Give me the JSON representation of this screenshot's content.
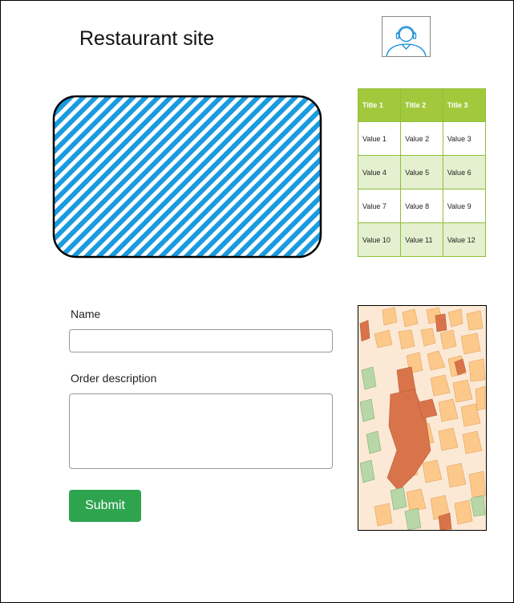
{
  "header": {
    "title": "Restaurant site",
    "avatar_icon": "user-headset-icon"
  },
  "hero": {
    "image_icon": "hatched-image-placeholder",
    "fill_color": "#1a9be0"
  },
  "table": {
    "headers": [
      "Title 1",
      "Title 2",
      "Title 3"
    ],
    "rows": [
      [
        "Value 1",
        "Value 2",
        "Value 3"
      ],
      [
        "Value 4",
        "Value 5",
        "Value 6"
      ],
      [
        "Value 7",
        "Value 8",
        "Value 9"
      ],
      [
        "Value 10",
        "Value 11",
        "Value 12"
      ]
    ],
    "header_color": "#a2c93c",
    "alt_row_color": "#e4f0cf"
  },
  "form": {
    "name_label": "Name",
    "name_value": "",
    "description_label": "Order description",
    "description_value": "",
    "submit_label": "Submit",
    "submit_color": "#2ea44f"
  },
  "map": {
    "icon": "city-map-icon"
  }
}
